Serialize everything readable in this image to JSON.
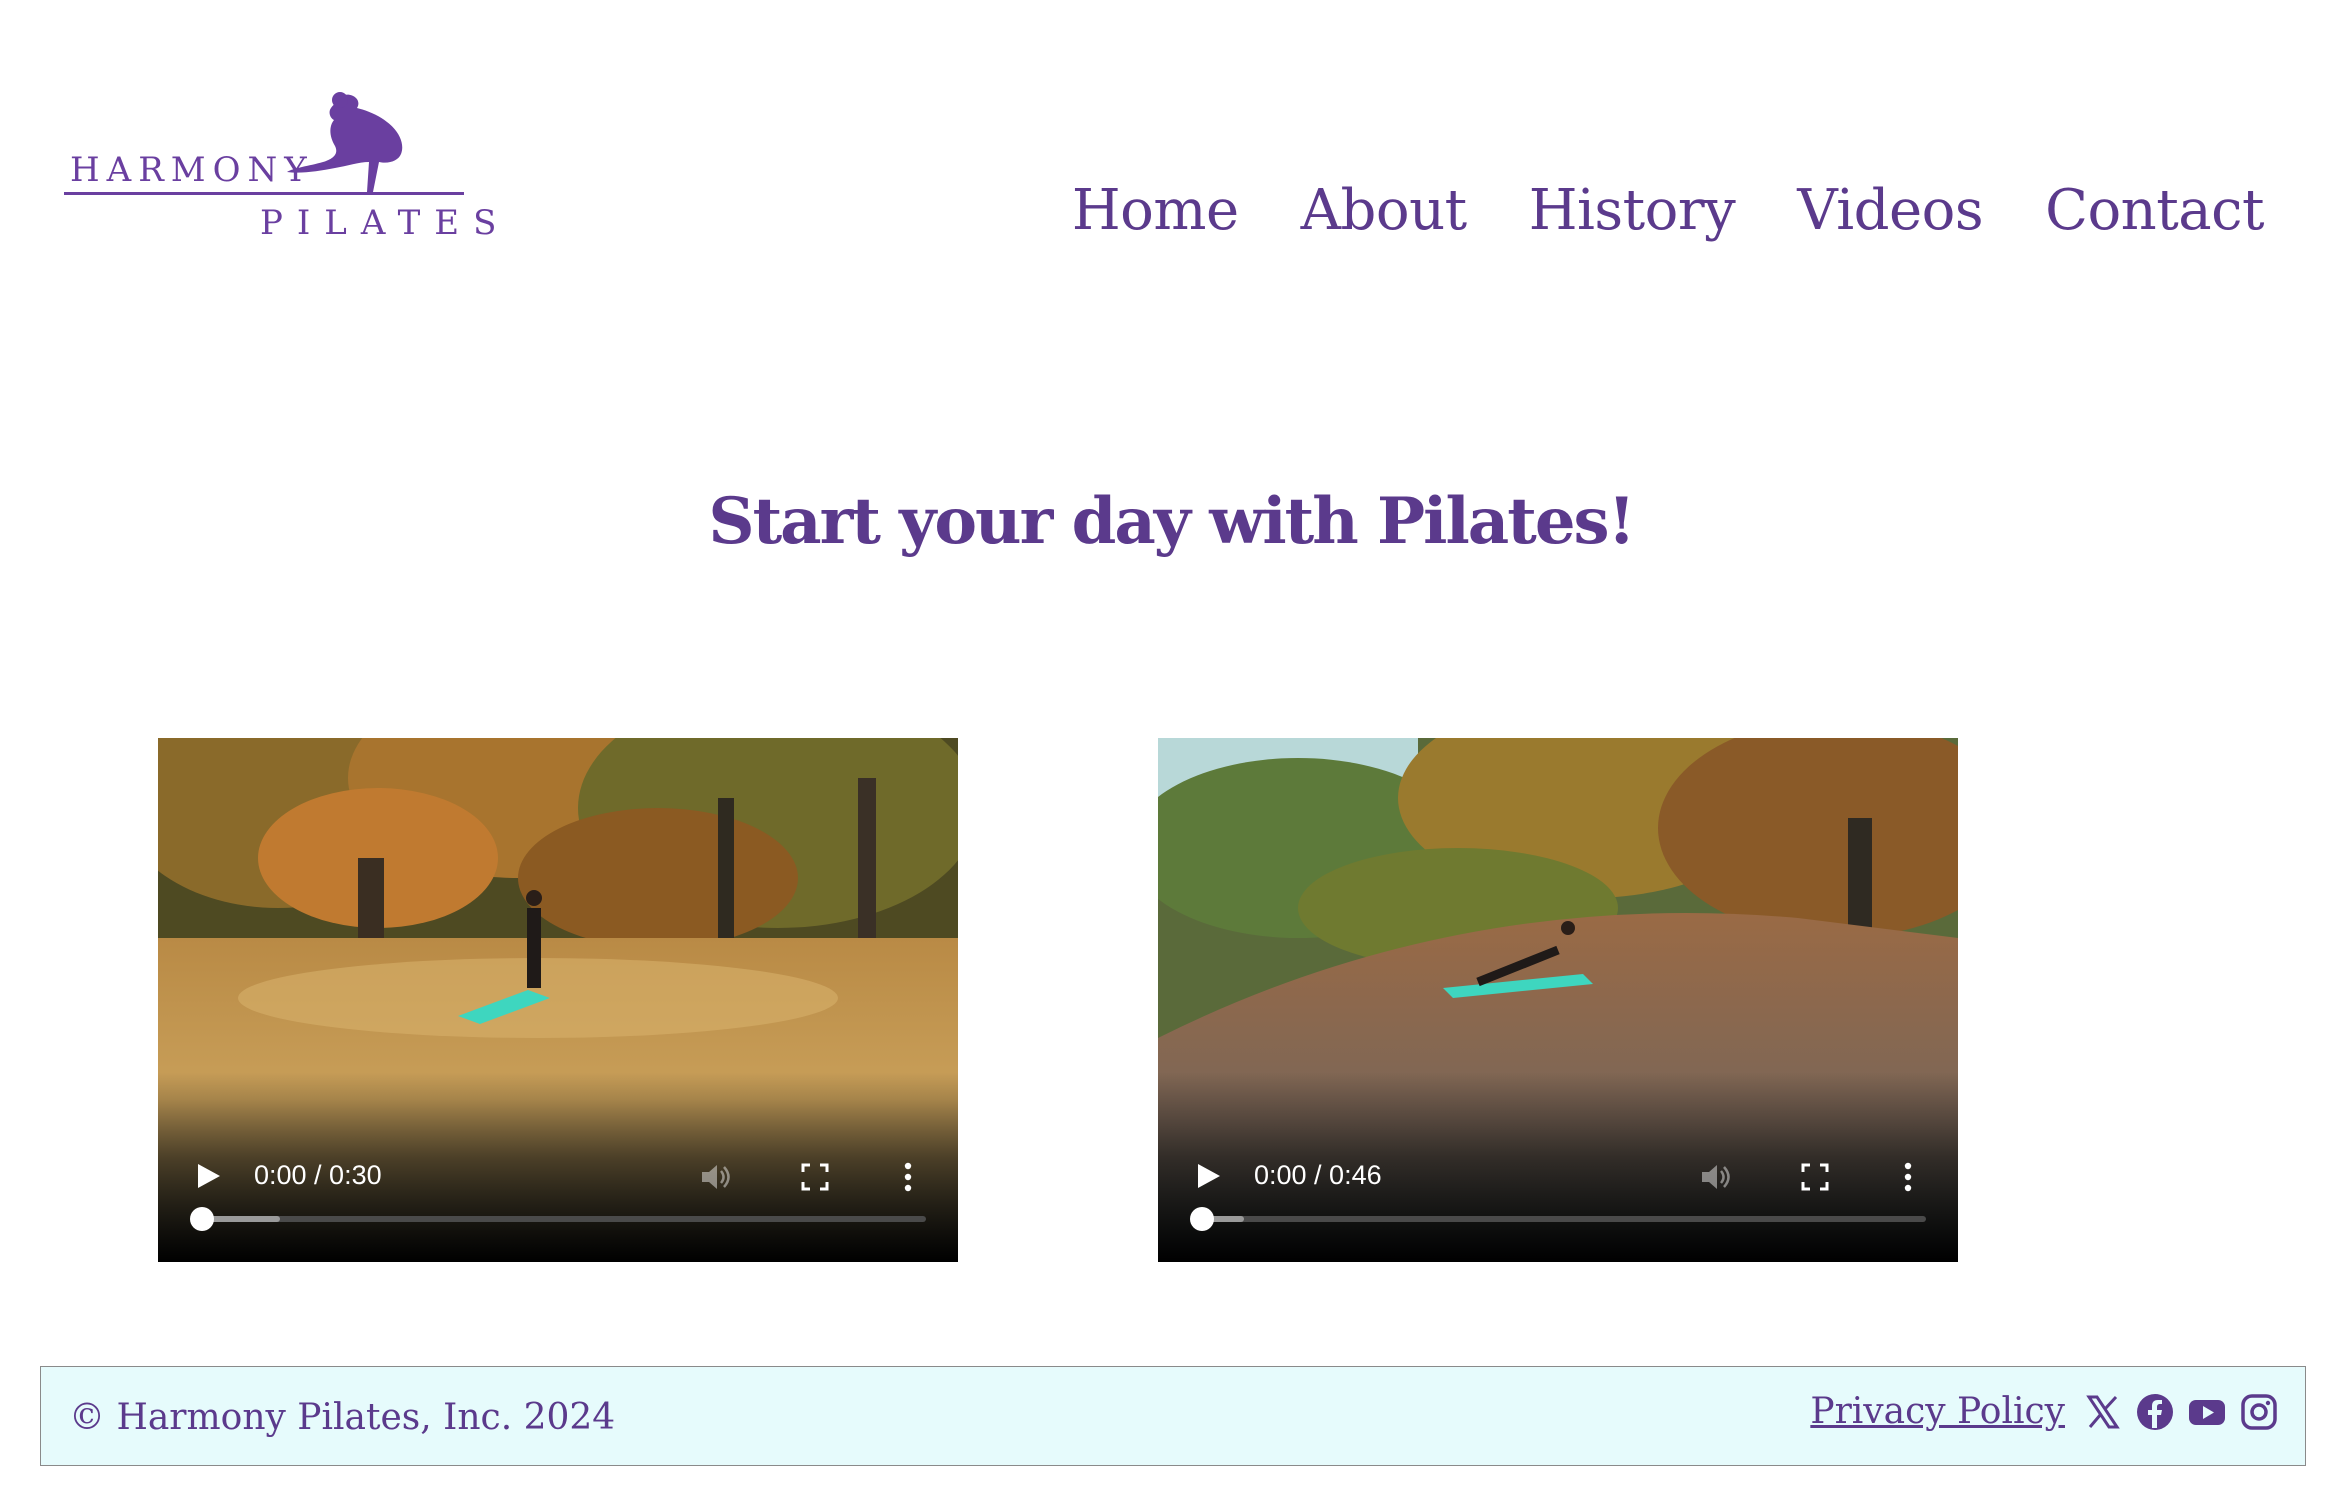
{
  "brand": {
    "logo_word_1": "HARMONY",
    "logo_word_2": "PILATES",
    "color": "#6a3fa0"
  },
  "nav": {
    "items": [
      {
        "label": "Home"
      },
      {
        "label": "About"
      },
      {
        "label": "History"
      },
      {
        "label": "Videos"
      },
      {
        "label": "Contact"
      }
    ]
  },
  "main": {
    "headline": "Start your day with Pilates!",
    "videos": [
      {
        "time": "0:00 / 0:30",
        "progress": 0,
        "buffered": 0.11,
        "icons": [
          "play-icon",
          "volume-icon",
          "fullscreen-icon",
          "more-options-icon"
        ]
      },
      {
        "time": "0:00 / 0:46",
        "progress": 0,
        "buffered": 0.06,
        "icons": [
          "play-icon",
          "volume-icon",
          "fullscreen-icon",
          "more-options-icon"
        ]
      }
    ]
  },
  "footer": {
    "copyright": "© Harmony Pilates, Inc. 2024",
    "privacy_label": "Privacy Policy",
    "social_icons": [
      "x-icon",
      "facebook-icon",
      "youtube-icon",
      "instagram-icon"
    ],
    "background": "#e6fbfc"
  },
  "colors": {
    "text_primary": "#5b3a8c",
    "mat": "#3ed6bf"
  }
}
